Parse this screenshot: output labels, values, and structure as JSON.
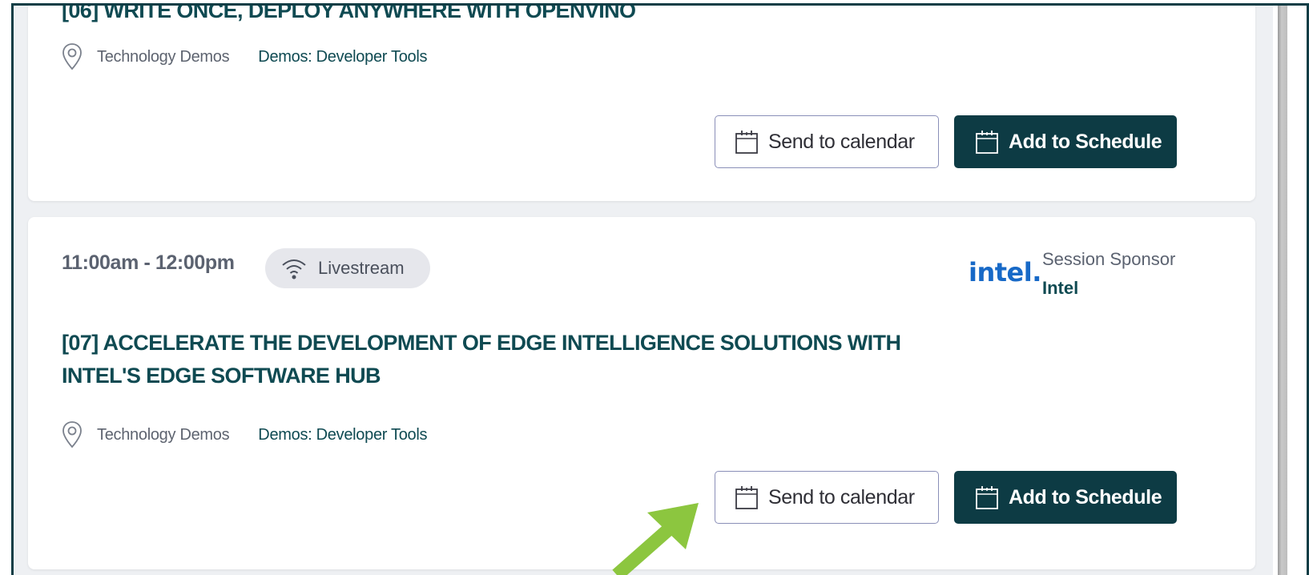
{
  "sessions": [
    {
      "title": "[06] WRITE ONCE, DEPLOY ANYWHERE WITH OPENVINO",
      "room": "Technology Demos",
      "track": "Demos: Developer Tools",
      "send_label": "Send to calendar",
      "add_label": "Add to Schedule"
    },
    {
      "time": "11:00am - 12:00pm",
      "badge": "Livestream",
      "sponsor_logo": "intel.",
      "sponsor_label": "Session Sponsor",
      "sponsor_name": "Intel",
      "title": "[07] ACCELERATE THE DEVELOPMENT OF EDGE INTELLIGENCE SOLUTIONS WITH INTEL'S EDGE SOFTWARE HUB",
      "room": "Technology Demos",
      "track": "Demos: Developer Tools",
      "send_label": "Send to calendar",
      "add_label": "Add to Schedule"
    }
  ],
  "icons": {
    "location": "location-pin-icon",
    "calendar": "calendar-icon",
    "livestream": "wifi-icon",
    "annotation": "green-arrow-icon"
  },
  "colors": {
    "primary": "#0d3b44",
    "title": "#0f4a52",
    "intel": "#1769c7",
    "annotation_arrow": "#8cc63f"
  }
}
